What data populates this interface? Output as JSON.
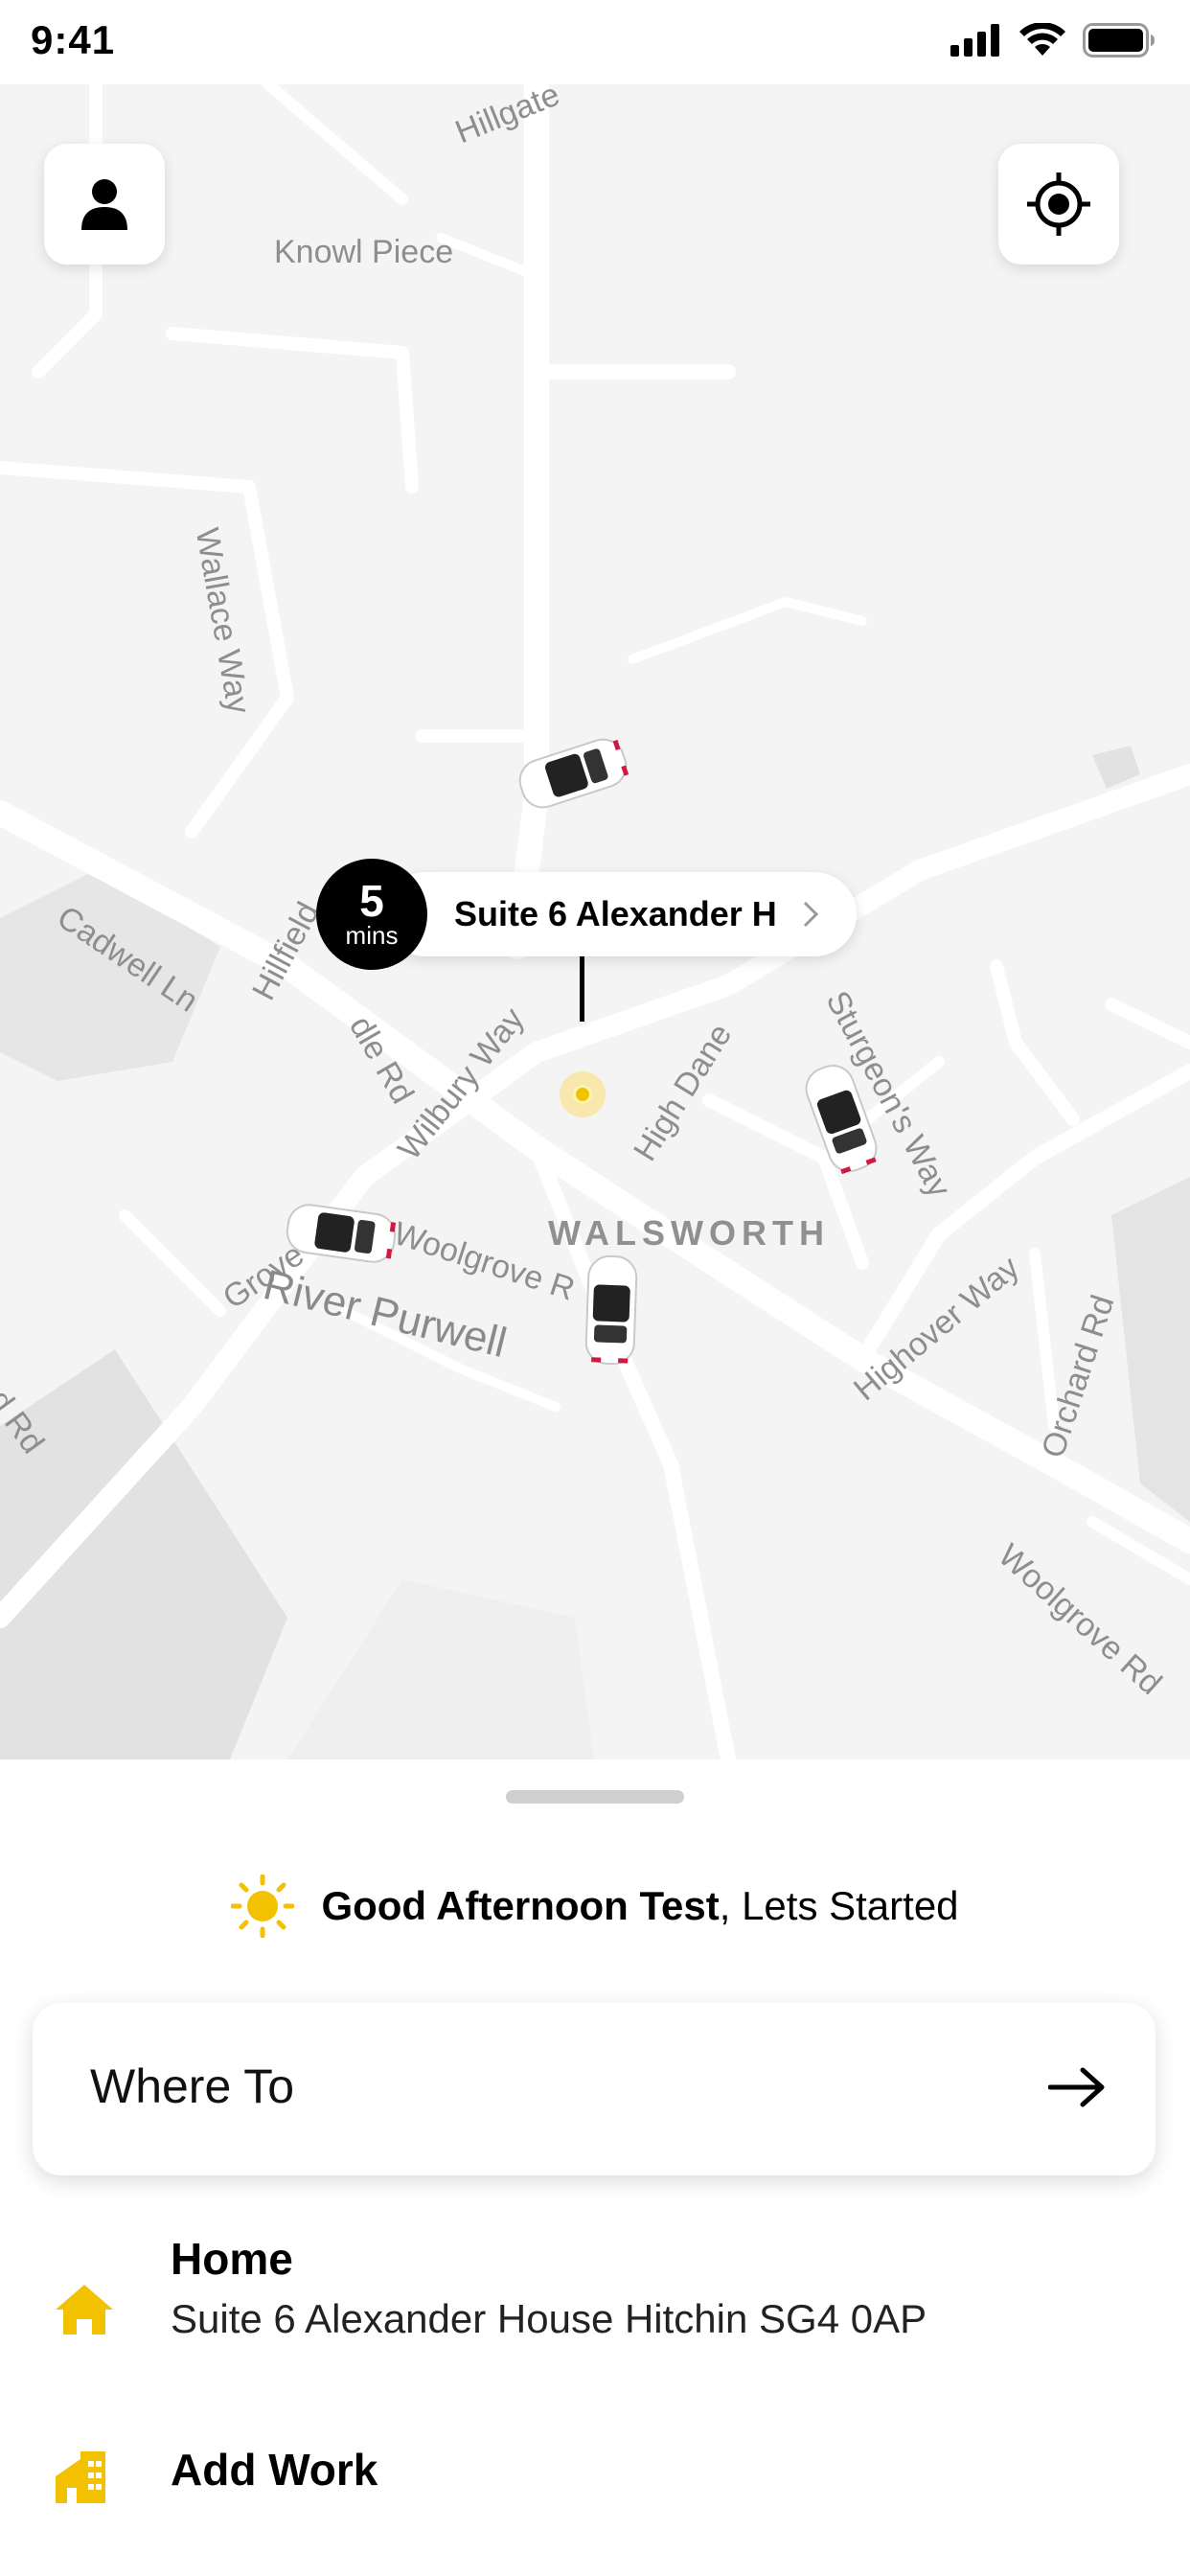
{
  "status_bar": {
    "time": "9:41"
  },
  "map": {
    "labels": {
      "hillgate": "Hillgate",
      "knowl_piece": "Knowl Piece",
      "wallace_way": "Wallace Way",
      "cadwell_ln": "Cadwell Ln",
      "hillfield": "Hillfield",
      "dale_rd": "dle Rd",
      "wilbury_way": "Wilbury Way",
      "high_dane": "High Dane",
      "sturgeons_way": "Sturgeon's Way",
      "walsworth": "WALSWORTH",
      "grove": "Grove",
      "woolgrove_rd": "Woolgrove R",
      "river_purwell": "River Purwell",
      "highover_way": "Highover Way",
      "orchard_rd": "Orchard Rd",
      "woolgrove_rd_2": "Woolgrove Rd",
      "ad_rd": "ad Rd"
    },
    "pickup": {
      "eta_value": "5",
      "eta_unit": "mins",
      "address": "Suite 6 Alexander H"
    },
    "colors": {
      "accent": "#F2C200",
      "pin_black": "#000000"
    }
  },
  "sheet": {
    "greeting_name": "Good Afternoon Test",
    "greeting_rest": ", Lets Started",
    "where_to": "Where To",
    "places": [
      {
        "icon": "home-icon",
        "title": "Home",
        "subtitle": "Suite 6 Alexander House Hitchin SG4 0AP"
      },
      {
        "icon": "building-icon",
        "title": "Add Work"
      }
    ]
  }
}
